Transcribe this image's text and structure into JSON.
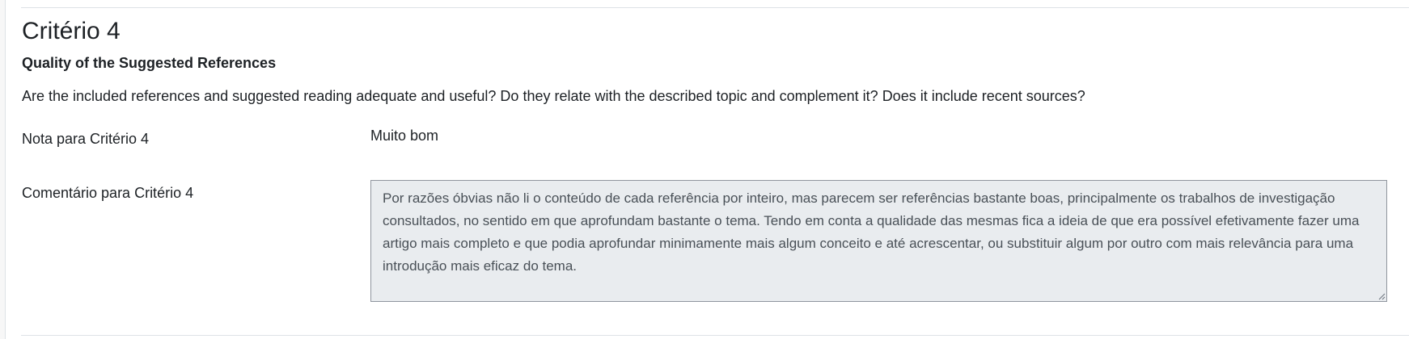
{
  "criterion": {
    "title": "Critério 4",
    "subtitle": "Quality of the Suggested References",
    "description": "Are the included references and suggested reading adequate and useful? Do they relate with the described topic and complement it? Does it include recent sources?"
  },
  "grade": {
    "label": "Nota para Critério 4",
    "value": "Muito bom"
  },
  "comment": {
    "label": "Comentário para Critério 4",
    "value": "Por razões óbvias não li o conteúdo de cada referência por inteiro, mas parecem ser referências bastante boas, principalmente os trabalhos de investigação consultados, no sentido em que aprofundam bastante o tema. Tendo em conta a qualidade das mesmas fica a ideia de que era possível efetivamente fazer uma artigo mais completo e que podia aprofundar minimamente mais algum conceito e até acrescentar, ou substituir algum por outro com mais relevância para uma introdução mais eficaz do tema."
  },
  "icons": {
    "resize": "resize-grip-icon"
  }
}
